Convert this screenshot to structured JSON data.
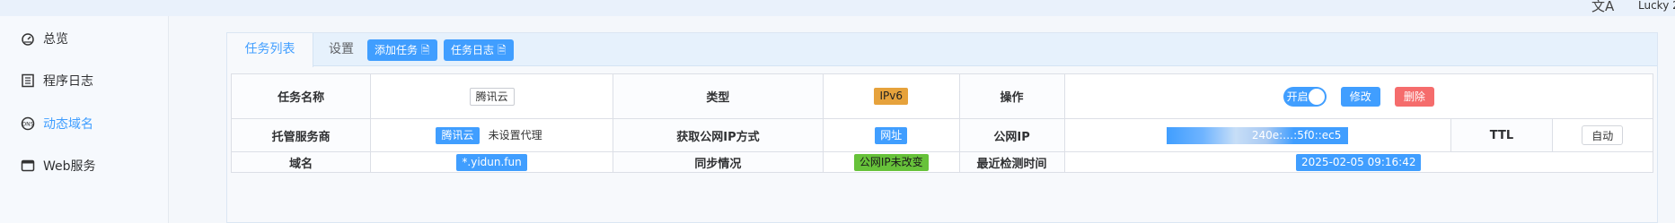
{
  "topbar": {
    "translate_glyph": "文A",
    "user": "Lucky 2"
  },
  "sidebar": {
    "items": [
      {
        "label": "总览",
        "icon": "dashboard-icon"
      },
      {
        "label": "程序日志",
        "icon": "log-icon"
      },
      {
        "label": "动态域名",
        "icon": "ddns-icon",
        "active": true
      },
      {
        "label": "Web服务",
        "icon": "web-icon"
      }
    ]
  },
  "tabs": {
    "active": "任务列表",
    "settings": "设置"
  },
  "toolbar": {
    "add_task": "添加任务",
    "task_log": "任务日志"
  },
  "task": {
    "name_label": "任务名称",
    "name": "腾讯云",
    "type_label": "类型",
    "type": "IPv6",
    "op_label": "操作",
    "switch_label": "开启",
    "edit": "修改",
    "delete": "删除",
    "provider_label": "托管服务商",
    "provider": "腾讯云",
    "proxy": "未设置代理",
    "ip_method_label": "获取公网IP方式",
    "ip_method": "网址",
    "public_ip_label": "公网IP",
    "public_ip": "240e:…:5f0::ec5",
    "ttl_label": "TTL",
    "ttl": "自动",
    "domain_label": "域名",
    "domain": "*.yidun.fun",
    "sync_label": "同步情况",
    "sync": "公网IP未改变",
    "last_check_label": "最近检测时间",
    "last_check": "2025-02-05 09:16:42"
  },
  "colors": {
    "primary": "#409eff",
    "orange": "#e6a23c",
    "green": "#67c23a",
    "red": "#f56c6c"
  }
}
